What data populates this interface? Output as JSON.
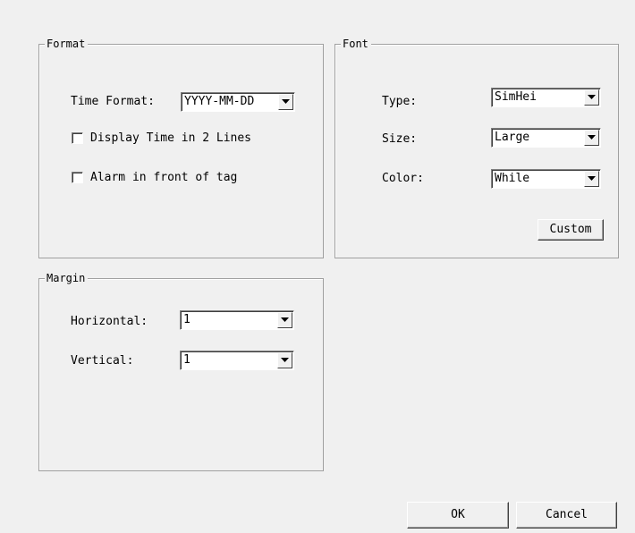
{
  "format": {
    "title": "Format",
    "time_format_label": "Time Format:",
    "time_format_value": "YYYY-MM-DD",
    "display_two_lines_label": "Display Time in 2 Lines",
    "display_two_lines_checked": false,
    "alarm_front_label": "Alarm in front of tag",
    "alarm_front_checked": false
  },
  "font": {
    "title": "Font",
    "type_label": "Type:",
    "type_value": "SimHei",
    "size_label": "Size:",
    "size_value": "Large",
    "color_label": "Color:",
    "color_value": "While",
    "custom_button": "Custom"
  },
  "margin": {
    "title": "Margin",
    "horizontal_label": "Horizontal:",
    "horizontal_value": "1",
    "vertical_label": "Vertical:",
    "vertical_value": "1"
  },
  "footer": {
    "ok_button": "OK",
    "cancel_button": "Cancel"
  },
  "icons": {
    "dropdown_arrow": "chevron-down-icon"
  }
}
